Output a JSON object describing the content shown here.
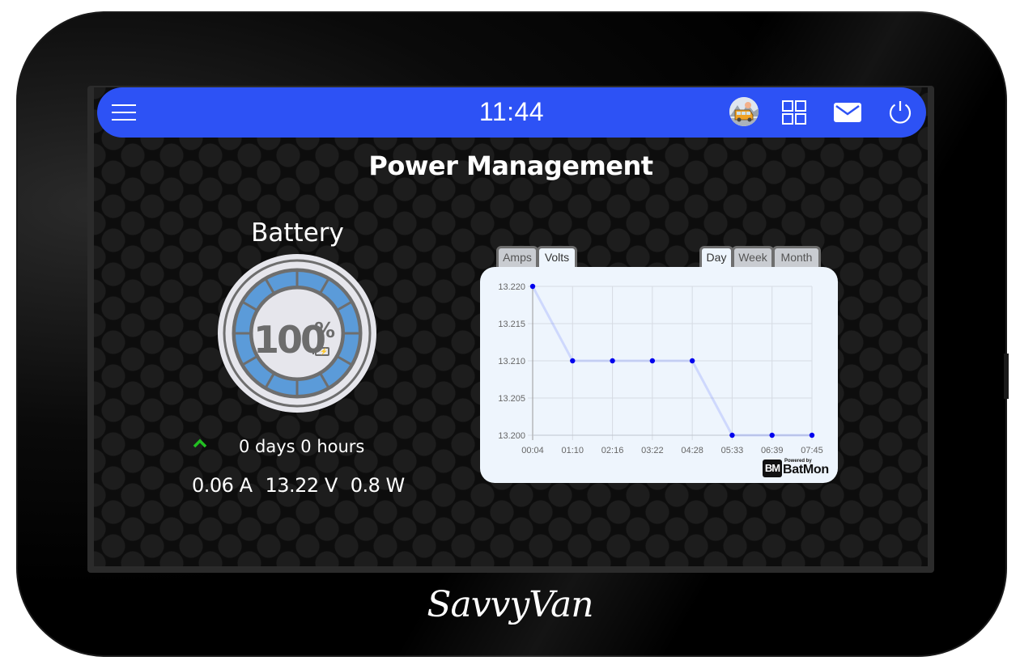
{
  "topbar": {
    "clock": "11:44",
    "icons": [
      "menu-icon",
      "van-avatar-icon",
      "apps-grid-icon",
      "mail-icon",
      "power-icon"
    ],
    "color": "#2d52f5"
  },
  "page": {
    "title": "Power Management"
  },
  "battery": {
    "title": "Battery",
    "charge_percent": 100,
    "percent_text": "100",
    "percent_sign": "%",
    "charging_symbol": "⚡",
    "trend": "up",
    "runtime": "0 days 0 hours",
    "amps": "0.06 A",
    "volts": "13.22 V",
    "watts": "0.8 W",
    "gauge_fill_color": "#5b9bd9",
    "trend_color": "#22c022"
  },
  "chart_tabs": {
    "metric": [
      {
        "label": "Amps",
        "active": false
      },
      {
        "label": "Volts",
        "active": true
      }
    ],
    "range": [
      {
        "label": "Day",
        "active": true
      },
      {
        "label": "Week",
        "active": false
      },
      {
        "label": "Month",
        "active": false
      }
    ]
  },
  "chart_data": {
    "type": "line",
    "title": "",
    "xlabel": "",
    "ylabel": "",
    "x": [
      "00:04",
      "01:10",
      "02:16",
      "03:22",
      "04:28",
      "05:33",
      "06:39",
      "07:45"
    ],
    "series": [
      {
        "name": "Volts",
        "values": [
          13.22,
          13.21,
          13.21,
          13.21,
          13.21,
          13.2,
          13.2,
          13.2
        ],
        "color": "#0000ee"
      }
    ],
    "yticks": [
      "13.220",
      "13.215",
      "13.210",
      "13.205",
      "13.200"
    ],
    "ylim": [
      13.2,
      13.22
    ],
    "grid": true,
    "legend": "none"
  },
  "chart_branding": {
    "badge": "BM",
    "powered_by": "Powered by",
    "name": "BatMon"
  },
  "device": {
    "brand": "SavvyVan"
  }
}
